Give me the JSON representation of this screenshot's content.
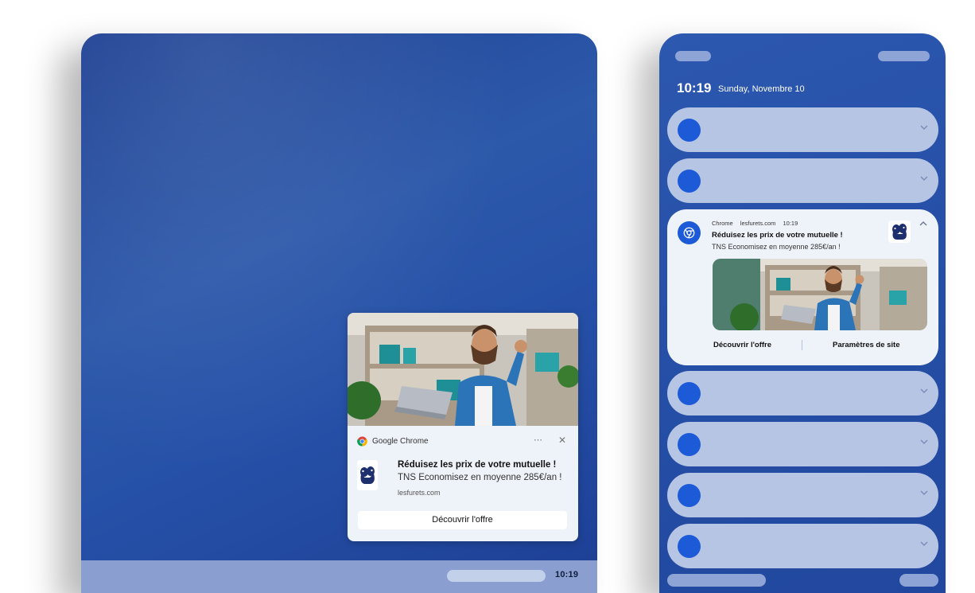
{
  "desktop": {
    "taskbar": {
      "clock": "10:19"
    },
    "toast": {
      "app_name": "Google Chrome",
      "more_icon": "more-horizontal-icon",
      "close_icon": "close-icon",
      "title": "Réduisez les prix de votre mutuelle !",
      "body": "TNS Economisez en moyenne 285€/an !",
      "domain": "lesfurets.com",
      "cta_label": "Découvrir l'offre"
    }
  },
  "phone": {
    "status": {
      "time": "10:19",
      "date": "Sunday, Novembre 10"
    },
    "expanded_notification": {
      "app": "Chrome",
      "domain": "lesfurets.com",
      "time": "10:19",
      "title": "Réduisez les prix de votre mutuelle !",
      "body": "TNS Economisez en moyenne 285€/an !",
      "actions": [
        "Découvrir l'offre",
        "Paramètres de site"
      ]
    }
  },
  "colors": {
    "wallpaper": "#2651a8",
    "notification_accent": "#1d5ad8",
    "collapsed_card": "#b7c5e4",
    "toast_background": "#eef2f9"
  }
}
